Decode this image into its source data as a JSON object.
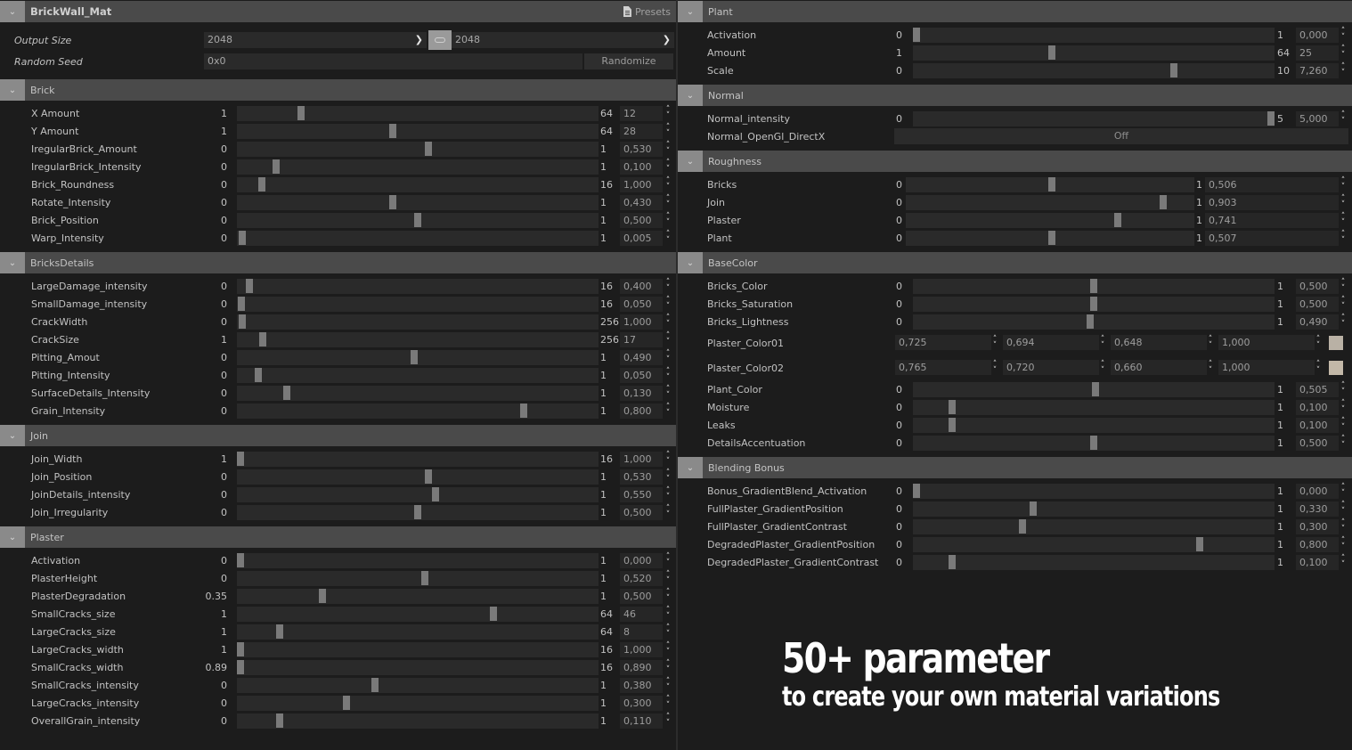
{
  "left": {
    "title": "BrickWall_Mat",
    "presets_label": "Presets",
    "output_size": {
      "label": "Output Size",
      "width": "2048",
      "height": "2048"
    },
    "random_seed": {
      "label": "Random Seed",
      "value": "0x0",
      "button": "Randomize"
    },
    "sections": [
      {
        "title": "Brick",
        "params": [
          {
            "label": "X Amount",
            "min": "1",
            "max": "64",
            "value": "12",
            "frac": 0.17
          },
          {
            "label": "Y Amount",
            "min": "1",
            "max": "64",
            "value": "28",
            "frac": 0.43
          },
          {
            "label": "IregularBrick_Amount",
            "min": "0",
            "max": "1",
            "value": "0,530",
            "frac": 0.53
          },
          {
            "label": "IregularBrick_Intensity",
            "min": "0",
            "max": "1",
            "value": "0,100",
            "frac": 0.1
          },
          {
            "label": "Brick_Roundness",
            "min": "0",
            "max": "16",
            "value": "1,000",
            "frac": 0.06
          },
          {
            "label": "Rotate_Intensity",
            "min": "0",
            "max": "1",
            "value": "0,430",
            "frac": 0.43
          },
          {
            "label": "Brick_Position",
            "min": "0",
            "max": "1",
            "value": "0,500",
            "frac": 0.5
          },
          {
            "label": "Warp_Intensity",
            "min": "0",
            "max": "1",
            "value": "0,005",
            "frac": 0.005
          }
        ]
      },
      {
        "title": "BricksDetails",
        "params": [
          {
            "label": "LargeDamage_intensity",
            "min": "0",
            "max": "16",
            "value": "0,400",
            "frac": 0.025
          },
          {
            "label": "SmallDamage_intensity",
            "min": "0",
            "max": "16",
            "value": "0,050",
            "frac": 0.003
          },
          {
            "label": "CrackWidth",
            "min": "0",
            "max": "256",
            "value": "1,000",
            "frac": 0.004
          },
          {
            "label": "CrackSize",
            "min": "1",
            "max": "256",
            "value": "17",
            "frac": 0.063
          },
          {
            "label": "Pitting_Amout",
            "min": "0",
            "max": "1",
            "value": "0,490",
            "frac": 0.49
          },
          {
            "label": "Pitting_Intensity",
            "min": "0",
            "max": "1",
            "value": "0,050",
            "frac": 0.05
          },
          {
            "label": "SurfaceDetails_Intensity",
            "min": "0",
            "max": "1",
            "value": "0,130",
            "frac": 0.13
          },
          {
            "label": "Grain_Intensity",
            "min": "0",
            "max": "1",
            "value": "0,800",
            "frac": 0.8
          }
        ]
      },
      {
        "title": "Join",
        "params": [
          {
            "label": "Join_Width",
            "min": "1",
            "max": "16",
            "value": "1,000",
            "frac": 0.0
          },
          {
            "label": "Join_Position",
            "min": "0",
            "max": "1",
            "value": "0,530",
            "frac": 0.53
          },
          {
            "label": "JoinDetails_intensity",
            "min": "0",
            "max": "1",
            "value": "0,550",
            "frac": 0.55
          },
          {
            "label": "Join_Irregularity",
            "min": "0",
            "max": "1",
            "value": "0,500",
            "frac": 0.5
          }
        ]
      },
      {
        "title": "Plaster",
        "params": [
          {
            "label": "Activation",
            "min": "0",
            "max": "1",
            "value": "0,000",
            "frac": 0.0
          },
          {
            "label": "PlasterHeight",
            "min": "0",
            "max": "1",
            "value": "0,520",
            "frac": 0.52
          },
          {
            "label": "PlasterDegradation",
            "min": "0.35",
            "max": "1",
            "value": "0,500",
            "frac": 0.23
          },
          {
            "label": "SmallCracks_size",
            "min": "1",
            "max": "64",
            "value": "46",
            "frac": 0.714
          },
          {
            "label": "LargeCracks_size",
            "min": "1",
            "max": "64",
            "value": "8",
            "frac": 0.111
          },
          {
            "label": "LargeCracks_width",
            "min": "1",
            "max": "16",
            "value": "1,000",
            "frac": 0.0
          },
          {
            "label": "SmallCracks_width",
            "min": "0.89",
            "max": "16",
            "value": "0,890",
            "frac": 0.0
          },
          {
            "label": "SmallCracks_intensity",
            "min": "0",
            "max": "1",
            "value": "0,380",
            "frac": 0.38
          },
          {
            "label": "LargeCracks_intensity",
            "min": "0",
            "max": "1",
            "value": "0,300",
            "frac": 0.3
          },
          {
            "label": "OverallGrain_intensity",
            "min": "0",
            "max": "1",
            "value": "0,110",
            "frac": 0.11
          }
        ]
      }
    ]
  },
  "right": {
    "sections": [
      {
        "title": "Plant",
        "params": [
          {
            "label": "Activation",
            "min": "0",
            "max": "1",
            "value": "0,000",
            "frac": 0.0
          },
          {
            "label": "Amount",
            "min": "1",
            "max": "64",
            "value": "25",
            "frac": 0.381
          },
          {
            "label": "Scale",
            "min": "0",
            "max": "10",
            "value": "7,260",
            "frac": 0.726
          }
        ]
      },
      {
        "title": "Normal",
        "params": [
          {
            "label": "Normal_intensity",
            "min": "0",
            "max": "5",
            "value": "5,000",
            "frac": 1.0
          }
        ],
        "toggle": {
          "label": "Normal_OpenGl_DirectX",
          "value": "Off"
        }
      },
      {
        "title": "Roughness",
        "compact": true,
        "params": [
          {
            "label": "Bricks",
            "min": "0",
            "max": "1",
            "value": "0,506",
            "frac": 0.506
          },
          {
            "label": "Join",
            "min": "0",
            "max": "1",
            "value": "0,903",
            "frac": 0.903
          },
          {
            "label": "Plaster",
            "min": "0",
            "max": "1",
            "value": "0,741",
            "frac": 0.741
          },
          {
            "label": "Plant",
            "min": "0",
            "max": "1",
            "value": "0,507",
            "frac": 0.507
          }
        ]
      },
      {
        "title": "BaseColor",
        "params": [
          {
            "label": "Bricks_Color",
            "min": "0",
            "max": "1",
            "value": "0,500",
            "frac": 0.5
          },
          {
            "label": "Bricks_Saturation",
            "min": "0",
            "max": "1",
            "value": "0,500",
            "frac": 0.5
          },
          {
            "label": "Bricks_Lightness",
            "min": "0",
            "max": "1",
            "value": "0,490",
            "frac": 0.49
          }
        ],
        "colors": [
          {
            "label": "Plaster_Color01",
            "r": "0,725",
            "g": "0,694",
            "b": "0,648",
            "a": "1,000",
            "swatch": "#b9b1a5"
          },
          {
            "label": "Plaster_Color02",
            "r": "0,765",
            "g": "0,720",
            "b": "0,660",
            "a": "1,000",
            "swatch": "#c3b8a8"
          }
        ],
        "params2": [
          {
            "label": "Plant_Color",
            "min": "0",
            "max": "1",
            "value": "0,505",
            "frac": 0.505
          },
          {
            "label": "Moisture",
            "min": "0",
            "max": "1",
            "value": "0,100",
            "frac": 0.1
          },
          {
            "label": "Leaks",
            "min": "0",
            "max": "1",
            "value": "0,100",
            "frac": 0.1
          },
          {
            "label": "DetailsAccentuation",
            "min": "0",
            "max": "1",
            "value": "0,500",
            "frac": 0.5
          }
        ]
      },
      {
        "title": "Blending Bonus",
        "params": [
          {
            "label": "Bonus_GradientBlend_Activation",
            "min": "0",
            "max": "1",
            "value": "0,000",
            "frac": 0.0
          },
          {
            "label": "FullPlaster_GradientPosition",
            "min": "0",
            "max": "1",
            "value": "0,330",
            "frac": 0.33
          },
          {
            "label": "FullPlaster_GradientContrast",
            "min": "0",
            "max": "1",
            "value": "0,300",
            "frac": 0.3
          },
          {
            "label": "DegradedPlaster_GradientPosition",
            "min": "0",
            "max": "1",
            "value": "0,800",
            "frac": 0.8
          },
          {
            "label": "DegradedPlaster_GradientContrast",
            "min": "0",
            "max": "1",
            "value": "0,100",
            "frac": 0.1
          }
        ]
      }
    ]
  },
  "promo": {
    "headline": "50+ parameter",
    "subline": "to create your own material variations"
  }
}
